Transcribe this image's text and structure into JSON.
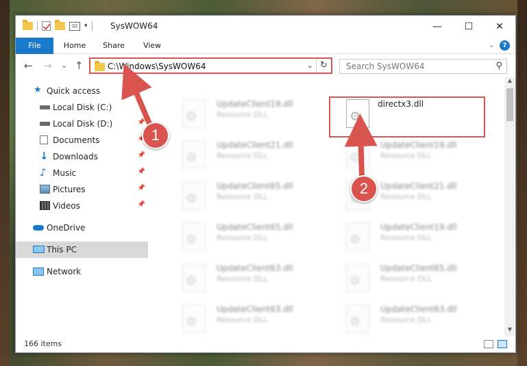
{
  "window": {
    "title": "SysWOW64",
    "controls": {
      "minimize": "—",
      "maximize": "☐",
      "close": "✕"
    }
  },
  "ribbon": {
    "tabs": [
      "File",
      "Home",
      "Share",
      "View"
    ],
    "help": "?",
    "collapse": "⌄"
  },
  "nav": {
    "back": "←",
    "forward": "→",
    "recent": "⌄",
    "up": "↑",
    "address": "C:\\Windows\\SysWOW64",
    "address_dropdown": "⌄",
    "refresh": "↻",
    "search_placeholder": "Search SysWOW64",
    "search_icon": "search-icon"
  },
  "sidebar": {
    "items": [
      {
        "label": "Quick access",
        "icon": "star-icon",
        "pinned": false
      },
      {
        "label": "Local Disk (C:)",
        "icon": "drive-icon",
        "pinned": false
      },
      {
        "label": "Local Disk (D:)",
        "icon": "drive-icon",
        "pinned": true
      },
      {
        "label": "Documents",
        "icon": "document-icon",
        "pinned": true
      },
      {
        "label": "Downloads",
        "icon": "download-icon",
        "pinned": true
      },
      {
        "label": "Music",
        "icon": "music-icon",
        "pinned": true
      },
      {
        "label": "Pictures",
        "icon": "picture-icon",
        "pinned": true
      },
      {
        "label": "Videos",
        "icon": "video-icon",
        "pinned": true
      },
      {
        "label": "OneDrive",
        "icon": "cloud-icon",
        "pinned": false
      },
      {
        "label": "This PC",
        "icon": "computer-icon",
        "pinned": false,
        "selected": true
      },
      {
        "label": "Network",
        "icon": "network-icon",
        "pinned": false
      }
    ]
  },
  "files": {
    "left_column": [
      {
        "name": "UpdateClient19.dll",
        "type": "Resource DLL"
      },
      {
        "name": "UpdateClient21.dll",
        "type": "Resource DLL"
      },
      {
        "name": "UpdateClient65.dll",
        "type": "Resource DLL"
      },
      {
        "name": "UpdateClient65.dll",
        "type": "Resource DLL"
      },
      {
        "name": "UpdateClient63.dll",
        "type": "Resource DLL"
      },
      {
        "name": "UpdateClient63.dll",
        "type": "Resource DLL"
      }
    ],
    "right_column": [
      {
        "name": "directx3.dll",
        "type": "",
        "highlighted": true
      },
      {
        "name": "UpdateClient19.dll",
        "type": "Resource DLL"
      },
      {
        "name": "UpdateClient21.dll",
        "type": "Resource DLL"
      },
      {
        "name": "UpdateClient19.dll",
        "type": "Resource DLL"
      },
      {
        "name": "UpdateClient65.dll",
        "type": "Resource DLL"
      },
      {
        "name": "UpdateClient63.dll",
        "type": "Resource DLL"
      }
    ]
  },
  "status": {
    "item_count": "166 items"
  },
  "annotations": {
    "badge1": "1",
    "badge2": "2",
    "color": "#d9534f"
  }
}
